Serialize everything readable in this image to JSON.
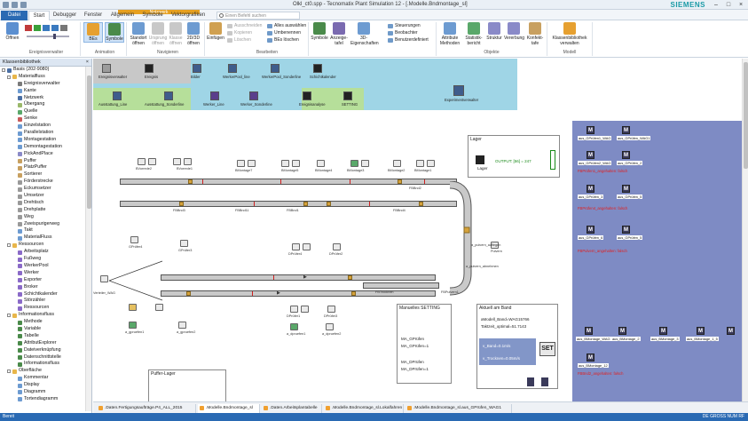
{
  "window": {
    "title": "Olkl_ct0.spp - Tecnomatix Plant Simulation 12 - [.Modelle.Bndmontage_sl]",
    "brand": "SIEMENS",
    "controls": [
      "–",
      "□",
      "×"
    ]
  },
  "tabs": {
    "file": "Datei",
    "items": [
      "Start",
      "Debugger",
      "Fenster",
      "Allgemein",
      "Symbole",
      "Vektorgrafiken"
    ],
    "context_group": "Netzwerk",
    "search_placeholder": "Einen Befehl suchen"
  },
  "ribbon": {
    "buttons": [
      {
        "label": "Öffnen",
        "icon": "open-folder-icon"
      },
      {
        "label": "BEs",
        "icon": "bes-icon",
        "selected": true
      },
      {
        "label": "Symbole",
        "icon": "symbols-icon",
        "selected": true
      },
      {
        "label": "Standort öffnen",
        "icon": "location-icon"
      },
      {
        "label": "Ursprung öffnen",
        "icon": "origin-icon",
        "disabled": true
      },
      {
        "label": "Klasse öffnen",
        "icon": "class-icon",
        "disabled": true
      },
      {
        "label": "2D/3D öffnen",
        "icon": "view-2d3d-icon"
      },
      {
        "label": "Einfügen",
        "icon": "paste-icon"
      },
      {
        "label": "Symbole",
        "icon": "symbols2-icon"
      },
      {
        "label": "Anzeige-tafel",
        "icon": "display-panel-icon"
      },
      {
        "label": "3D-Eigenschaften",
        "icon": "3d-props-icon"
      },
      {
        "label": "Attribute Methoden",
        "icon": "attributes-icon"
      },
      {
        "label": "Statistik-bericht",
        "icon": "statistics-icon"
      },
      {
        "label": "Struktur",
        "icon": "structure-icon"
      },
      {
        "label": "Vererbung",
        "icon": "inheritance-icon"
      },
      {
        "label": "Konfekt-tafe",
        "icon": "config-icon"
      },
      {
        "label": "Klassenbibliothek verwalten",
        "icon": "library-icon"
      }
    ],
    "small_items": [
      {
        "label": "Ausschneiden",
        "disabled": true
      },
      {
        "label": "Kopieren",
        "disabled": true
      },
      {
        "label": "Löschen",
        "disabled": true
      },
      {
        "label": "Alles auswählen",
        "disabled": false
      },
      {
        "label": "Umbenennen",
        "disabled": false
      },
      {
        "label": "BEs löschen",
        "disabled": false
      },
      {
        "label": "Steuerungen",
        "disabled": false
      },
      {
        "label": "Beobachter",
        "disabled": false
      },
      {
        "label": "Benutzerdefiniert",
        "disabled": false
      }
    ],
    "groups": [
      "Ereignisverwalter",
      "Animation",
      "Navigieren",
      "Bearbeiten",
      "Objekte",
      "Modell"
    ]
  },
  "left_panel": {
    "title": "Klassenbibliothek",
    "items": [
      {
        "label": "Basis (202-9080)",
        "level": 0,
        "expander": true,
        "icon": "#4a6fa5"
      },
      {
        "label": "Materialfluss",
        "level": 1,
        "expander": true,
        "icon": "#e8b64a"
      },
      {
        "label": "Ereignisverwalter",
        "level": 2,
        "icon": "#7a7a7a"
      },
      {
        "label": "Kante",
        "level": 2,
        "icon": "#6d9bd1"
      },
      {
        "label": "Netzwerk",
        "level": 2,
        "icon": "#4a6fa5"
      },
      {
        "label": "Übergang",
        "level": 2,
        "icon": "#9ab86a"
      },
      {
        "label": "Quelle",
        "level": 2,
        "icon": "#5aa86a"
      },
      {
        "label": "Senke",
        "level": 2,
        "icon": "#c85a5a"
      },
      {
        "label": "Einzelstation",
        "level": 2,
        "icon": "#6d9bd1"
      },
      {
        "label": "Parallelstation",
        "level": 2,
        "icon": "#6d9bd1"
      },
      {
        "label": "Montagestation",
        "level": 2,
        "icon": "#6d9bd1"
      },
      {
        "label": "Demontagestation",
        "level": 2,
        "icon": "#6d9bd1"
      },
      {
        "label": "PickAndPlace",
        "level": 2,
        "icon": "#8a8ac8"
      },
      {
        "label": "Puffer",
        "level": 2,
        "icon": "#c8a060"
      },
      {
        "label": "PlatzPuffer",
        "level": 2,
        "icon": "#c8a060"
      },
      {
        "label": "Sortierer",
        "level": 2,
        "icon": "#c8a060"
      },
      {
        "label": "Förderstrecke",
        "level": 2,
        "icon": "#999999"
      },
      {
        "label": "Eckumsetzer",
        "level": 2,
        "icon": "#999999"
      },
      {
        "label": "Umsetzer",
        "level": 2,
        "icon": "#999999"
      },
      {
        "label": "Drehtisch",
        "level": 2,
        "icon": "#999999"
      },
      {
        "label": "Drehplatte",
        "level": 2,
        "icon": "#999999"
      },
      {
        "label": "Weg",
        "level": 2,
        "icon": "#999999"
      },
      {
        "label": "Zweispurigerweg",
        "level": 2,
        "icon": "#999999"
      },
      {
        "label": "Takt",
        "level": 2,
        "icon": "#6d9bd1"
      },
      {
        "label": "MaterialFluss",
        "level": 2,
        "icon": "#6d9bd1"
      },
      {
        "label": "Ressourcen",
        "level": 1,
        "expander": true,
        "icon": "#e8b64a"
      },
      {
        "label": "Arbeitsplatz",
        "level": 2,
        "icon": "#8a6ac8"
      },
      {
        "label": "Fußweg",
        "level": 2,
        "icon": "#8a6ac8"
      },
      {
        "label": "WerkerPool",
        "level": 2,
        "icon": "#8a6ac8"
      },
      {
        "label": "Werker",
        "level": 2,
        "icon": "#8a6ac8"
      },
      {
        "label": "Exporter",
        "level": 2,
        "icon": "#8a6ac8"
      },
      {
        "label": "Broker",
        "level": 2,
        "icon": "#8a6ac8"
      },
      {
        "label": "Schichtkalender",
        "level": 2,
        "icon": "#8a6ac8"
      },
      {
        "label": "Störzähler",
        "level": 2,
        "icon": "#8a6ac8"
      },
      {
        "label": "Ressourcen",
        "level": 2,
        "icon": "#8a6ac8"
      },
      {
        "label": "Informationsfluss",
        "level": 1,
        "expander": true,
        "icon": "#e8b64a"
      },
      {
        "label": "Methode",
        "level": 2,
        "icon": "#4a8a4a"
      },
      {
        "label": "Variable",
        "level": 2,
        "icon": "#4a8a4a"
      },
      {
        "label": "Tabelle",
        "level": 2,
        "icon": "#4a8a4a"
      },
      {
        "label": "AttributExplorer",
        "level": 2,
        "icon": "#4a8a4a"
      },
      {
        "label": "Dateiverknüpfung",
        "level": 2,
        "icon": "#4a8a4a"
      },
      {
        "label": "Datenschnittstelle",
        "level": 2,
        "icon": "#4a8a4a"
      },
      {
        "label": "Informationsfluss",
        "level": 2,
        "icon": "#4a8a4a"
      },
      {
        "label": "Oberfläche",
        "level": 1,
        "expander": true,
        "icon": "#e8b64a"
      },
      {
        "label": "Kommentar",
        "level": 2,
        "icon": "#6d9bd1"
      },
      {
        "label": "Display",
        "level": 2,
        "icon": "#6d9bd1"
      },
      {
        "label": "Diagramm",
        "level": 2,
        "icon": "#6d9bd1"
      },
      {
        "label": "Tortendiagramm",
        "level": 2,
        "icon": "#6d9bd1"
      }
    ]
  },
  "canvas": {
    "toolbar_icons": [
      {
        "label": "Ereignisverwalter"
      },
      {
        "label": "Ereignis"
      },
      {
        "label": "Bilder"
      },
      {
        "label": "WerkerPool_line"
      },
      {
        "label": "WerkerPool_Sonderline"
      },
      {
        "label": "Schichtkalender"
      },
      {
        "label": "Ausstattung_Line"
      },
      {
        "label": "Ausstattung_Sonderline"
      },
      {
        "label": "Werker_Line"
      },
      {
        "label": "Werker_Sonderline"
      },
      {
        "label": "Ereignisanalyse"
      },
      {
        "label": "SETTING"
      },
      {
        "label": "Experimentverwalter"
      }
    ],
    "station_labels": [
      "BVorrede2",
      "BVorrede1",
      "BMontage7",
      "BMontage5",
      "BMontage4",
      "BMontage3",
      "BMontage2",
      "BMontage1",
      "GPrüfer4",
      "GPrüfer3",
      "DPrüfer4",
      "DPrüfer2",
      "DPrüfer1",
      "DPrüfer3",
      "a_gpruefen1",
      "a_gpruefen2",
      "a_dpruefen1",
      "a_dpruefen2",
      "a_pulvern_auflegen",
      "a_pulvern_abnehmen",
      "Pulvern",
      "Verteiler_WAG",
      "FBPulvern1",
      "FBTrocknen",
      "FBBnd1",
      "FBBnd2",
      "FBBnd3",
      "FBBnd11",
      "FBBnd4"
    ],
    "lager_box": {
      "title": "Lager",
      "output": "OUTPUT: [56] = 247",
      "item": "Lager"
    },
    "settings_box": {
      "title": "Manuelles SETTING",
      "fields": [
        "MA_GPrüfen",
        "MA_GPrüfen=1",
        "MA_DPrüfen",
        "MA_DPrüfen=1"
      ]
    },
    "band_box": {
      "title": "Aktuell am Band",
      "model": "aModell_Band=WAG15766",
      "takt": "Taktzeit_optimal=51.7143",
      "speed": "v_Band=0.1m/s",
      "trocknen": "v_Trocknen=0.05m/s",
      "set_label": "SET"
    },
    "puffer_box": {
      "title": "Puffer-Lager"
    },
    "right_area": {
      "groups": [
        {
          "labels": [
            "aus_GPrüfen1_WAG",
            "aus_GPrüfen_WAG1"
          ],
          "status": "FBPrüfen1_angehalten: falsch"
        },
        {
          "labels": [
            "aus_GPrüfen2_WAG",
            "aus_GPrüfen_2",
            "aus_GPrüfen_3"
          ],
          "status": "FBPrüfen4_angehalten: falsch"
        },
        {
          "labels": [
            "aus_GPrüfen_5",
            "aus_GPrüfen_6"
          ],
          "status": "FBPulvern_angehalten: falsch"
        },
        {
          "labels": [
            "aus_BMontage_WAG",
            "aus_BMontage_2",
            "aus_BMontage_3",
            "aus_BMontage_1_5",
            "aus_BMontage_12"
          ],
          "status": "FBBnd2_angehalten: falsch"
        }
      ]
    }
  },
  "doc_tabs": [
    ".Daten.Fertigungsaufträge.P4_ALL_2015",
    ".Modelle.Bndmontage_sl",
    ".Daten.Arbeitsplantabelle",
    ".Modelle.Bndmontage_sl.Lokalfahren",
    ".Modelle.Bndmontage_sl.aus_GPrüfen_WAG1"
  ],
  "status": {
    "left": "Bereit",
    "right": "DE  GROSS  NUM  RF"
  },
  "colors": {
    "file_tab": "#2a6ab3",
    "context_tab": "#e6a020",
    "status_bar": "#2a6ab3",
    "band_top": "#9fd5e6",
    "band_green": "#b6df9a",
    "right_area": "#7e8bc4",
    "pallet": "#d6a23c",
    "alert_text": "#e02020"
  }
}
